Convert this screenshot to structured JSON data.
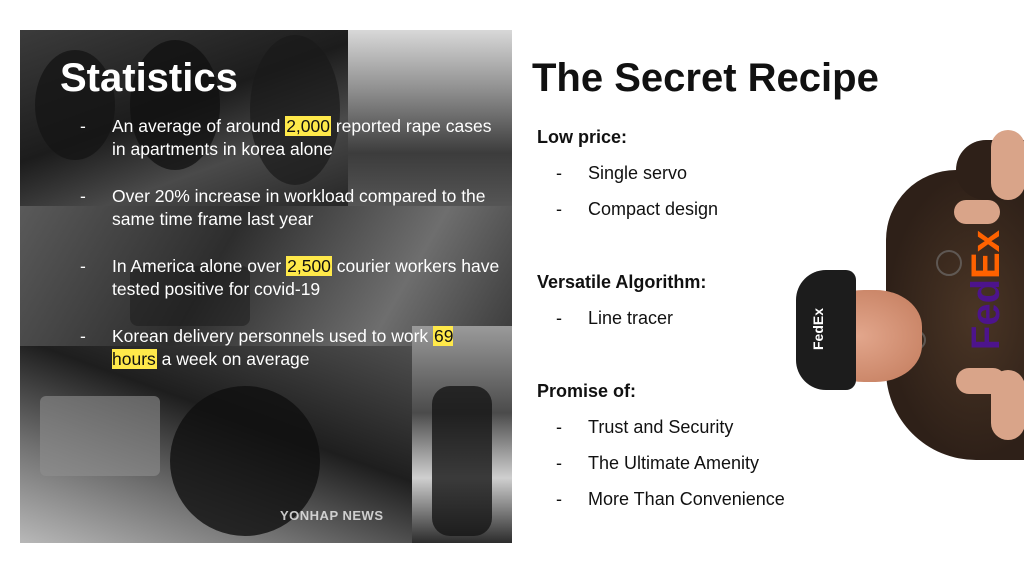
{
  "left_panel": {
    "title": "Statistics",
    "watermark": "YONHAP NEWS",
    "items": [
      {
        "dash": "-",
        "pre": "An average of around ",
        "highlight": "2,000",
        "post": "  reported rape cases in apartments in korea alone"
      },
      {
        "dash": "-",
        "text": "Over 20% increase in workload compared to the same time frame last year"
      },
      {
        "dash": "-",
        "pre": "In America alone over ",
        "highlight": "2,500",
        "post": " courier workers have tested positive for covid-19"
      },
      {
        "dash": "-",
        "pre": "Korean delivery personnels used to work ",
        "highlight": "69 hours",
        "post": " a week on average"
      }
    ],
    "highlight_color": "#ffe94a"
  },
  "right_panel": {
    "title": "The Secret Recipe",
    "sections": [
      {
        "heading": "Low price:",
        "items": [
          "Single servo",
          "Compact design"
        ]
      },
      {
        "heading": "Versatile Algorithm:",
        "items": [
          "Line tracer"
        ]
      },
      {
        "heading": "Promise of:",
        "items": [
          "Trust and Security",
          "The Ultimate Amenity",
          "More Than Convenience"
        ]
      }
    ],
    "dash": "-"
  },
  "mascot": {
    "cap_logo": "FedEx",
    "shirt_logo_part1": "Fed",
    "shirt_logo_part2": "Ex",
    "logo_colors": {
      "fed": "#4d148c",
      "ex": "#ff6200"
    }
  }
}
